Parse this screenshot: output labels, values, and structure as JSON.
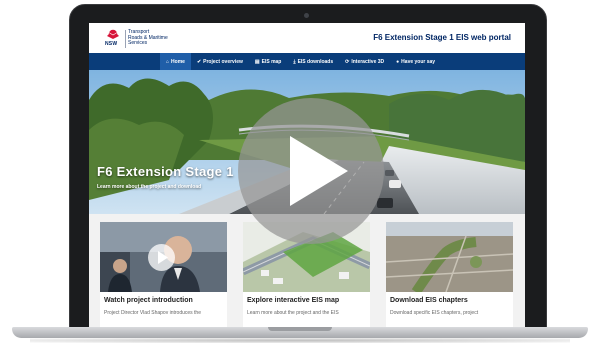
{
  "header": {
    "nsw_logo_text": "NSW",
    "agency_lines": [
      "Transport",
      "Roads & Maritime",
      "Services"
    ],
    "portal_title": "F6 Extension Stage 1 EIS web portal"
  },
  "nav": {
    "items": [
      {
        "icon": "home-icon",
        "glyph": "⌂",
        "label": "Home",
        "active": true
      },
      {
        "icon": "check-icon",
        "glyph": "✔",
        "label": "Project overview",
        "active": false
      },
      {
        "icon": "map-icon",
        "glyph": "▤",
        "label": "EIS map",
        "active": false
      },
      {
        "icon": "download-icon",
        "glyph": "⤓",
        "label": "EIS downloads",
        "active": false
      },
      {
        "icon": "refresh-icon",
        "glyph": "⟳",
        "label": "Interactive 3D",
        "active": false
      },
      {
        "icon": "speech-bubble-icon",
        "glyph": "●",
        "label": "Have your say",
        "active": false
      }
    ]
  },
  "hero": {
    "title": "F6 Extension Stage 1",
    "subtitle": "Learn more about the project and download"
  },
  "cards": [
    {
      "title": "Watch project introduction",
      "text": "Project Director Vlad Shapov introduces the"
    },
    {
      "title": "Explore interactive EIS map",
      "text": "Learn more about the project and the EIS"
    },
    {
      "title": "Download EIS chapters",
      "text": "Download specific EIS chapters, project"
    }
  ],
  "colors": {
    "nav_background": "#0a3d7a",
    "nav_active": "#1f5ea8",
    "brand_navy": "#002664",
    "nsw_red": "#d7153a"
  }
}
